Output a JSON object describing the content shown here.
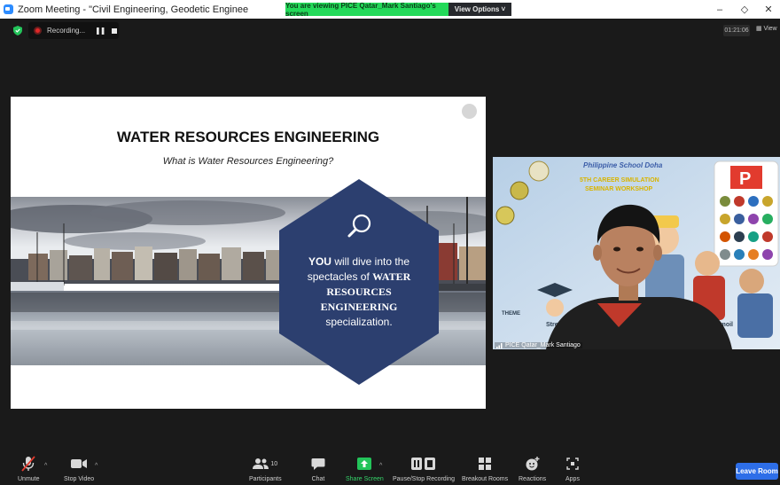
{
  "window": {
    "title": "Zoom Meeting - \"Civil Engineering, Geodetic Enginee",
    "viewing_banner": "You are viewing PICE Qatar_Mark Santiago's screen",
    "view_options": "View Options ˅",
    "minimize": "–",
    "maximize": "◇",
    "close": "✕"
  },
  "status": {
    "recording": "Recording...",
    "timer": "01:21:06",
    "view": "▦ View"
  },
  "slide": {
    "title": "WATER RESOURCES ENGINEERING",
    "subtitle": "What is Water Resources Engineering?",
    "hex_you": "YOU",
    "hex_line1": " will dive into the spectacles of ",
    "hex_bold": "WATER RESOURCES ENGINEERING",
    "hex_tail": "specialization."
  },
  "speaker": {
    "name": "PICE Qatar_Mark Santiago",
    "bg_title": "Philippine School Doha",
    "bg_line1": "5TH CAREER SIMULATION",
    "bg_line2": "SEMINAR WORKSHOP",
    "bg_theme": "THEME",
    "bg_stre": "Stre",
    "bg_turmoil": "e Turmoil"
  },
  "toolbar": {
    "unmute": "Unmute",
    "stop_video": "Stop Video",
    "participants": "Participants",
    "participants_count": "10",
    "chat": "Chat",
    "share_screen": "Share Screen",
    "pause_stop_recording": "Pause/Stop Recording",
    "breakout_rooms": "Breakout Rooms",
    "reactions": "Reactions",
    "apps": "Apps",
    "leave": "Leave Room"
  },
  "colors": {
    "accent_green": "#23d959",
    "leave_blue": "#2d6ee8",
    "hex_navy": "#2c3f6f"
  }
}
